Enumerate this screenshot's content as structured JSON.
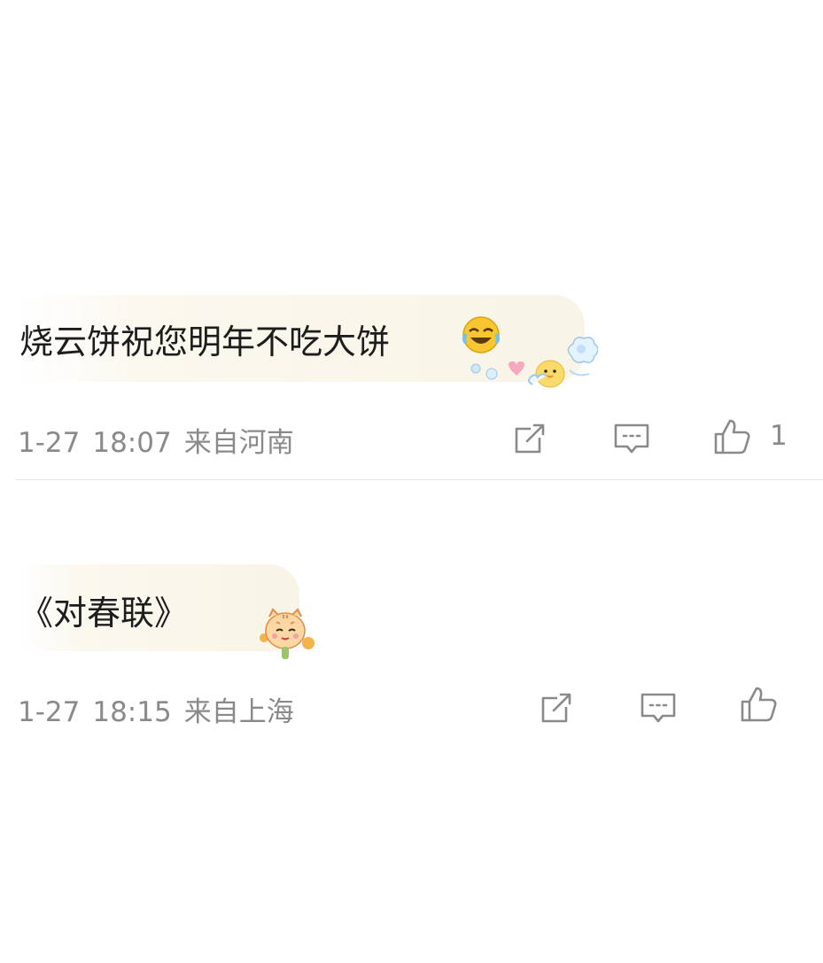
{
  "comments": [
    {
      "text": "烧云饼祝您明年不吃大饼",
      "emoji": "laughing-crying-face",
      "date": "1-27",
      "time": "18:07",
      "location": "来自河南",
      "like_count": "1",
      "bubble_decoration": "duck-and-cloud-sticker"
    },
    {
      "text": "《对春联》",
      "date": "1-27",
      "time": "18:15",
      "location": "来自上海",
      "like_count": "",
      "bubble_decoration": "tiger-cub-sticker"
    }
  ],
  "icons": {
    "share": "share-icon",
    "comment": "comment-icon",
    "like": "like-icon"
  },
  "colors": {
    "meta_text": "#8a8a8a",
    "bubble_bg": "#f8f4e6"
  }
}
